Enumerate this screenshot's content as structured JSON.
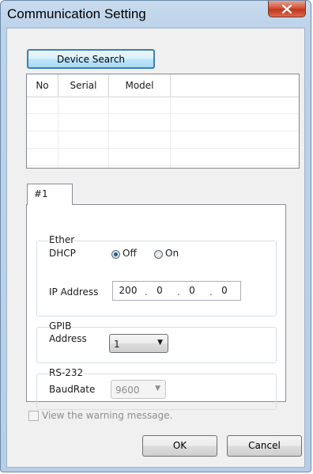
{
  "window": {
    "title": "Communication Setting"
  },
  "toolbar": {
    "device_search_label": "Device Search"
  },
  "device_table": {
    "columns": [
      "No",
      "Serial",
      "Model"
    ],
    "rows": []
  },
  "tabs": [
    {
      "label": "#1"
    }
  ],
  "ether": {
    "group_label": "Ether",
    "dhcp_label": "DHCP",
    "dhcp_off_label": "Off",
    "dhcp_on_label": "On",
    "dhcp_selected": "Off",
    "ip_label": "IP Address",
    "ip_octets": [
      "200",
      "0",
      "0",
      "0"
    ],
    "ip_separator": "."
  },
  "gpib": {
    "group_label": "GPIB",
    "address_label": "Address",
    "address_value": "1",
    "dropdown_arrow": "▼"
  },
  "rs232": {
    "group_label": "RS-232",
    "baudrate_label": "BaudRate",
    "baudrate_value": "9600",
    "dropdown_arrow": "▼"
  },
  "warning_checkbox": {
    "label": "View the warning message.",
    "checked": false
  },
  "buttons": {
    "ok": "OK",
    "cancel": "Cancel"
  },
  "close_glyph": "✕"
}
